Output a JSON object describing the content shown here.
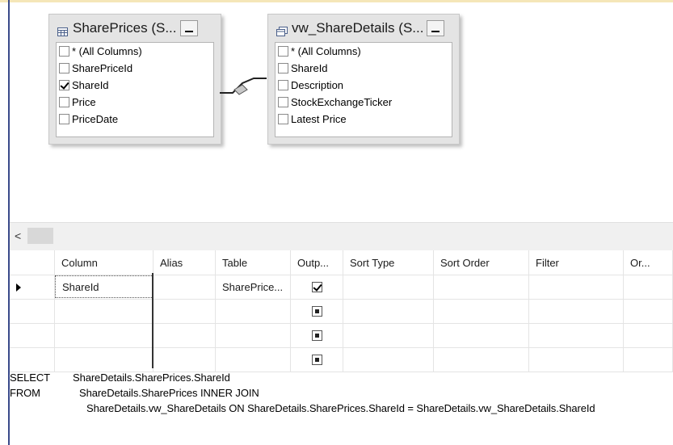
{
  "diagram": {
    "tables": [
      {
        "title": "SharePrices (S...",
        "columns": [
          {
            "label": "* (All Columns)",
            "checked": false
          },
          {
            "label": "SharePriceId",
            "checked": false
          },
          {
            "label": "ShareId",
            "checked": true
          },
          {
            "label": "Price",
            "checked": false
          },
          {
            "label": "PriceDate",
            "checked": false
          }
        ]
      },
      {
        "title": "vw_ShareDetails (S...",
        "columns": [
          {
            "label": "* (All Columns)",
            "checked": false
          },
          {
            "label": "ShareId",
            "checked": false
          },
          {
            "label": "Description",
            "checked": false
          },
          {
            "label": "StockExchangeTicker",
            "checked": false
          },
          {
            "label": "Latest Price",
            "checked": false
          }
        ]
      }
    ],
    "scroll_left_glyph": "<"
  },
  "grid": {
    "headers": [
      "Column",
      "Alias",
      "Table",
      "Outp...",
      "Sort Type",
      "Sort Order",
      "Filter",
      "Or..."
    ],
    "rows": [
      {
        "column": "ShareId",
        "alias": "",
        "table": "SharePrice...",
        "output": "checked",
        "current": true
      },
      {
        "column": "",
        "alias": "",
        "table": "",
        "output": "indeterminate",
        "current": false
      },
      {
        "column": "",
        "alias": "",
        "table": "",
        "output": "indeterminate",
        "current": false
      },
      {
        "column": "",
        "alias": "",
        "table": "",
        "output": "indeterminate",
        "current": false
      }
    ]
  },
  "sql": {
    "select_kw": "SELECT",
    "select_text": "ShareDetails.SharePrices.ShareId",
    "from_kw": "FROM",
    "from_text": "ShareDetails.SharePrices INNER JOIN",
    "join_text": "ShareDetails.vw_ShareDetails ON ShareDetails.SharePrices.ShareId = ShareDetails.vw_ShareDetails.ShareId"
  }
}
